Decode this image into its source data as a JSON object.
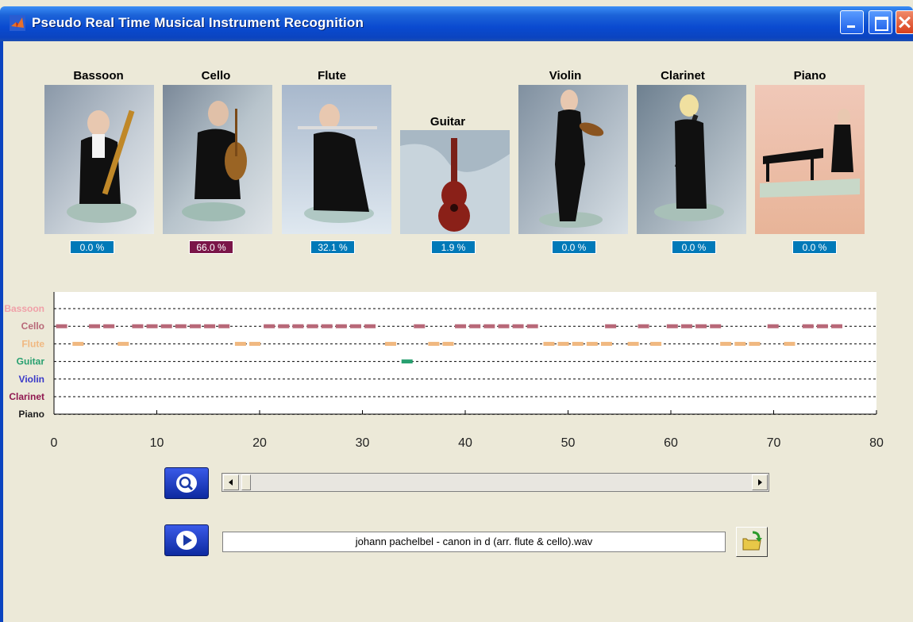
{
  "window": {
    "title": "Pseudo Real Time Musical Instrument Recognition",
    "titlebar_color": "#0b44c0"
  },
  "instruments": [
    {
      "name": "Bassoon",
      "percent": "0.0 %",
      "highlight": false
    },
    {
      "name": "Cello",
      "percent": "66.0 %",
      "highlight": true
    },
    {
      "name": "Flute",
      "percent": "32.1 %",
      "highlight": false
    },
    {
      "name": "Guitar",
      "percent": "1.9 %",
      "highlight": false
    },
    {
      "name": "Violin",
      "percent": "0.0 %",
      "highlight": false
    },
    {
      "name": "Clarinet",
      "percent": "0.0 %",
      "highlight": false
    },
    {
      "name": "Piano",
      "percent": "0.0 %",
      "highlight": false
    }
  ],
  "chart_data": {
    "type": "scatter",
    "xlim": [
      0,
      80
    ],
    "x_ticks": [
      "0",
      "10",
      "20",
      "30",
      "40",
      "50",
      "60",
      "70",
      "80"
    ],
    "grid": "horizontal dashed",
    "series": [
      {
        "name": "Bassoon",
        "color": "#f0a0a8",
        "segments": []
      },
      {
        "name": "Cello",
        "color": "#b86878",
        "segments": [
          0.2,
          3.4,
          4.8,
          7.6,
          9.0,
          10.4,
          11.8,
          13.2,
          14.6,
          16.0,
          20.4,
          21.8,
          23.2,
          24.6,
          26.0,
          27.4,
          28.8,
          30.2,
          35.0,
          39.0,
          40.4,
          41.8,
          43.2,
          44.6,
          46.0,
          53.6,
          56.8,
          59.6,
          61.0,
          62.4,
          63.8,
          69.4,
          72.8,
          74.2,
          75.6
        ]
      },
      {
        "name": "Flute",
        "color": "#f0b880",
        "segments": [
          1.8,
          6.2,
          17.6,
          19.0,
          32.2,
          36.4,
          37.8,
          47.6,
          49.0,
          50.4,
          51.8,
          53.2,
          55.8,
          58.0,
          64.8,
          66.2,
          67.6,
          71.0
        ]
      },
      {
        "name": "Guitar",
        "color": "#28a070",
        "segments": [
          33.8
        ]
      },
      {
        "name": "Violin",
        "color": "#3838c8",
        "segments": []
      },
      {
        "name": "Clarinet",
        "color": "#901850",
        "segments": []
      },
      {
        "name": "Piano",
        "color": "#202020",
        "segments": []
      }
    ]
  },
  "controls": {
    "analyze_button_icon": "magnifier-icon",
    "play_button_icon": "play-icon",
    "file_name": "johann pachelbel - canon in d (arr. flute & cello).wav",
    "open_button_icon": "open-folder-icon",
    "scroll_position": 0
  }
}
